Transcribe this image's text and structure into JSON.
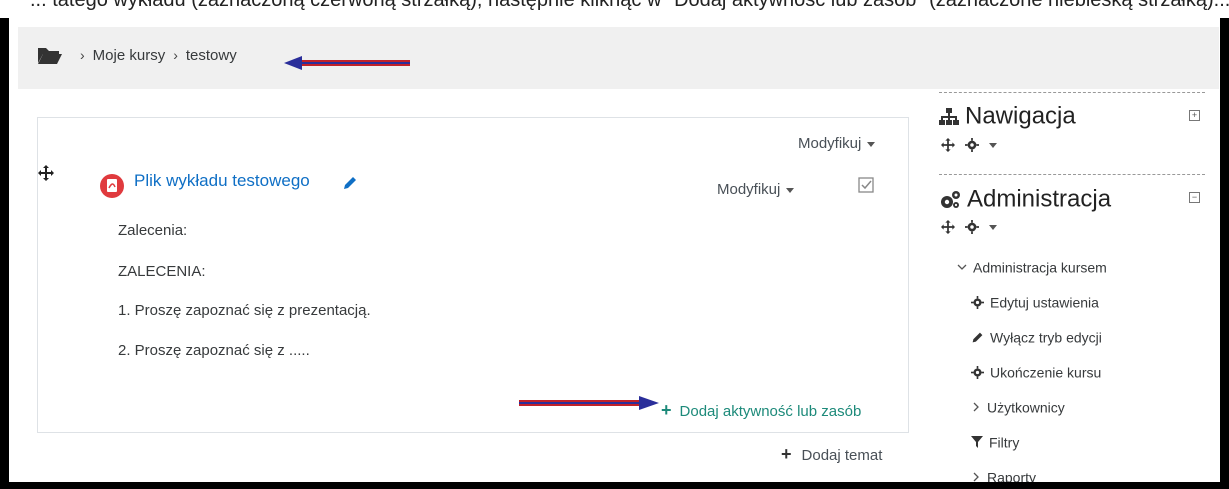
{
  "top_cut_text": "... tatego wykładu (zaznaczoną czerwoną strzałką), następnie kliknąć w \"Dodaj aktywność lub zasób\" (zaznaczone niebieską strzałką)...",
  "breadcrumb": {
    "icon": "folder-open-icon",
    "items": [
      "Moje kursy",
      "testowy"
    ],
    "separator": "›"
  },
  "section": {
    "modify_label": "Modyfikuj",
    "activity": {
      "title": "Plik wykładu testowego",
      "icon": "pdf-icon",
      "modify_label": "Modyfikuj",
      "lines": [
        "Zalecenia:",
        "ZALECENIA:",
        "1. Proszę zapoznać się z prezentacją.",
        "2. Proszę zapoznać się z ....."
      ]
    },
    "add_activity_label": "Dodaj aktywność lub zasób",
    "add_topic_label": "Dodaj temat"
  },
  "blocks": {
    "navigation": {
      "title": "Nawigacja",
      "icon": "sitemap-icon"
    },
    "administration": {
      "title": "Administracja",
      "icon": "cogs-icon",
      "items": [
        {
          "label": "Administracja kursem",
          "icon": "chevron-down-icon"
        },
        {
          "label": "Edytuj ustawienia",
          "icon": "gear-icon"
        },
        {
          "label": "Wyłącz tryb edycji",
          "icon": "pencil-icon"
        },
        {
          "label": "Ukończenie kursu",
          "icon": "gear-icon"
        },
        {
          "label": "Użytkownicy",
          "icon": "chevron-right-icon"
        },
        {
          "label": "Filtry",
          "icon": "filter-icon"
        },
        {
          "label": "Raporty",
          "icon": "chevron-right-icon"
        }
      ]
    }
  },
  "colors": {
    "link": "#0f6fc5",
    "add_activity": "#1d8a7a",
    "arrow_red": "#c0202a",
    "arrow_blue": "#2a2e9a",
    "pdf_red": "#e03a3e"
  }
}
